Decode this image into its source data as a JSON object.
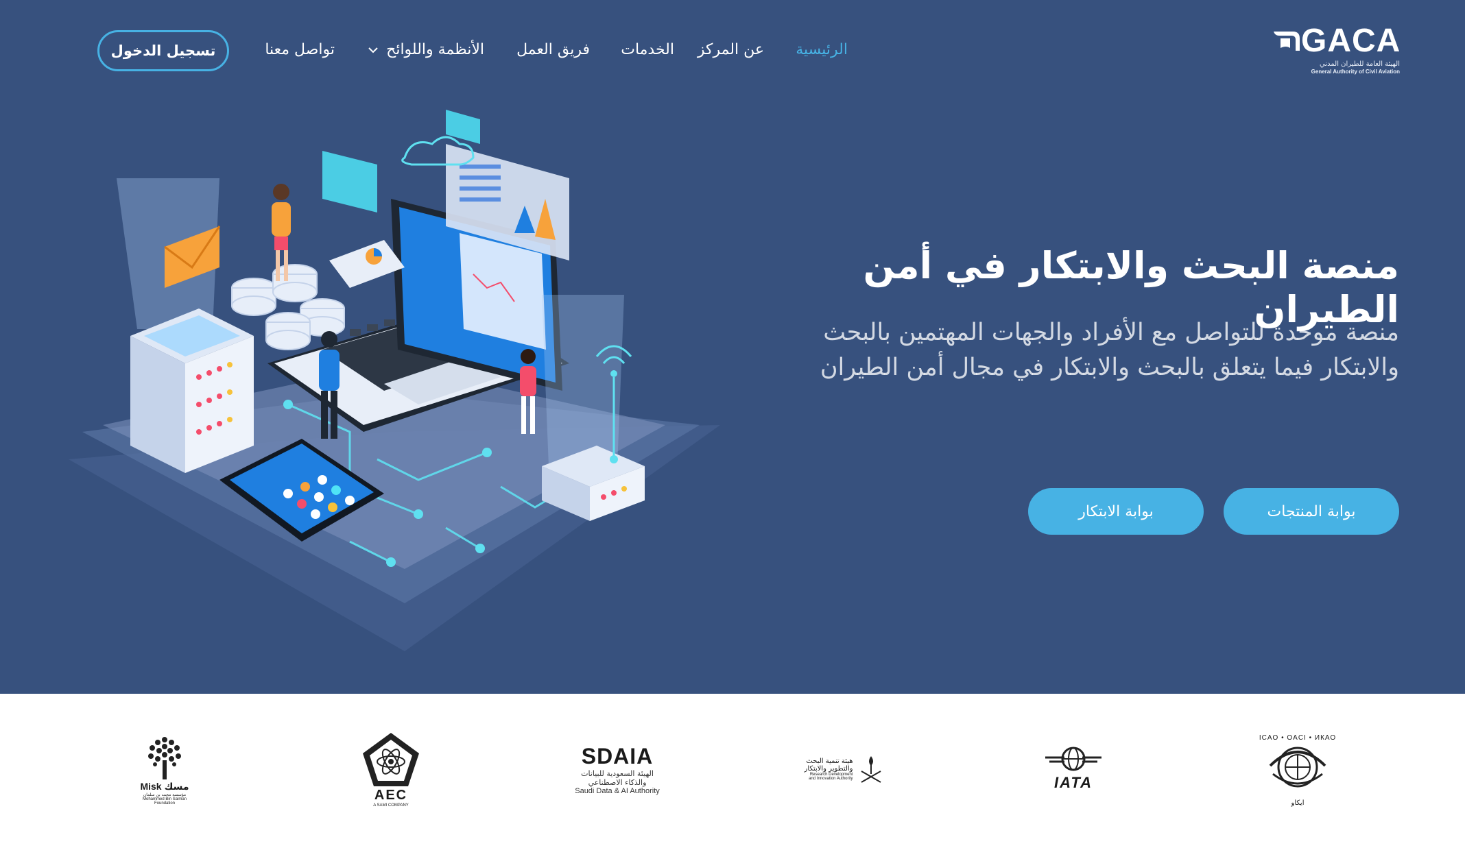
{
  "brand": {
    "name": "GACA",
    "subtitle_ar": "الهيئة العامة للطيران المدني",
    "subtitle_en": "General Authority of Civil Aviation"
  },
  "nav": {
    "items": [
      {
        "label": "الرئيسية",
        "active": true
      },
      {
        "label": "عن المركز",
        "active": false
      },
      {
        "label": "الخدمات",
        "active": false
      },
      {
        "label": "فريق العمل",
        "active": false
      },
      {
        "label": "الأنظمة واللوائح",
        "active": false,
        "dropdown": true
      },
      {
        "label": "تواصل معنا",
        "active": false
      }
    ],
    "login_label": "تسجيل الدخول"
  },
  "hero": {
    "title": "منصة البحث والابتكار في أمن الطيران",
    "description": "منصة موحدة للتواصل مع الأفراد والجهات المهتمين بالبحث والابتكار فيما يتعلق بالبحث والابتكار في مجال أمن الطيران",
    "buttons": {
      "products": "بوابة المنتجات",
      "innovation": "بوابة الابتكار"
    }
  },
  "partners": {
    "icao": {
      "ring_text": "ICAO • OACI • ИКАО",
      "bottom_ar": "ايكاو"
    },
    "iata": {
      "name": "IATA"
    },
    "rdia": {
      "line1": "هيئة تنمية البحث",
      "line2": "والتطوير والابتكار",
      "line3": "Research Development",
      "line4": "and Innovation Authority"
    },
    "sdaia": {
      "name": "SDAIA",
      "line_ar1": "الهيئة السعودية للبيانات",
      "line_ar2": "والذكاء الاصطناعي",
      "line_en": "Saudi Data & AI Authority"
    },
    "aec": {
      "name": "AEC",
      "sub": "A SAMI COMPANY"
    },
    "misk": {
      "name_en": "Misk",
      "name_ar": "مسك",
      "line_ar": "مؤسسة محمد بن سلمان",
      "line_en1": "Mohammed Bin Salman",
      "line_en2": "Foundation"
    }
  },
  "colors": {
    "hero_bg": "#37517e",
    "accent": "#47b2e4",
    "white": "#ffffff"
  }
}
